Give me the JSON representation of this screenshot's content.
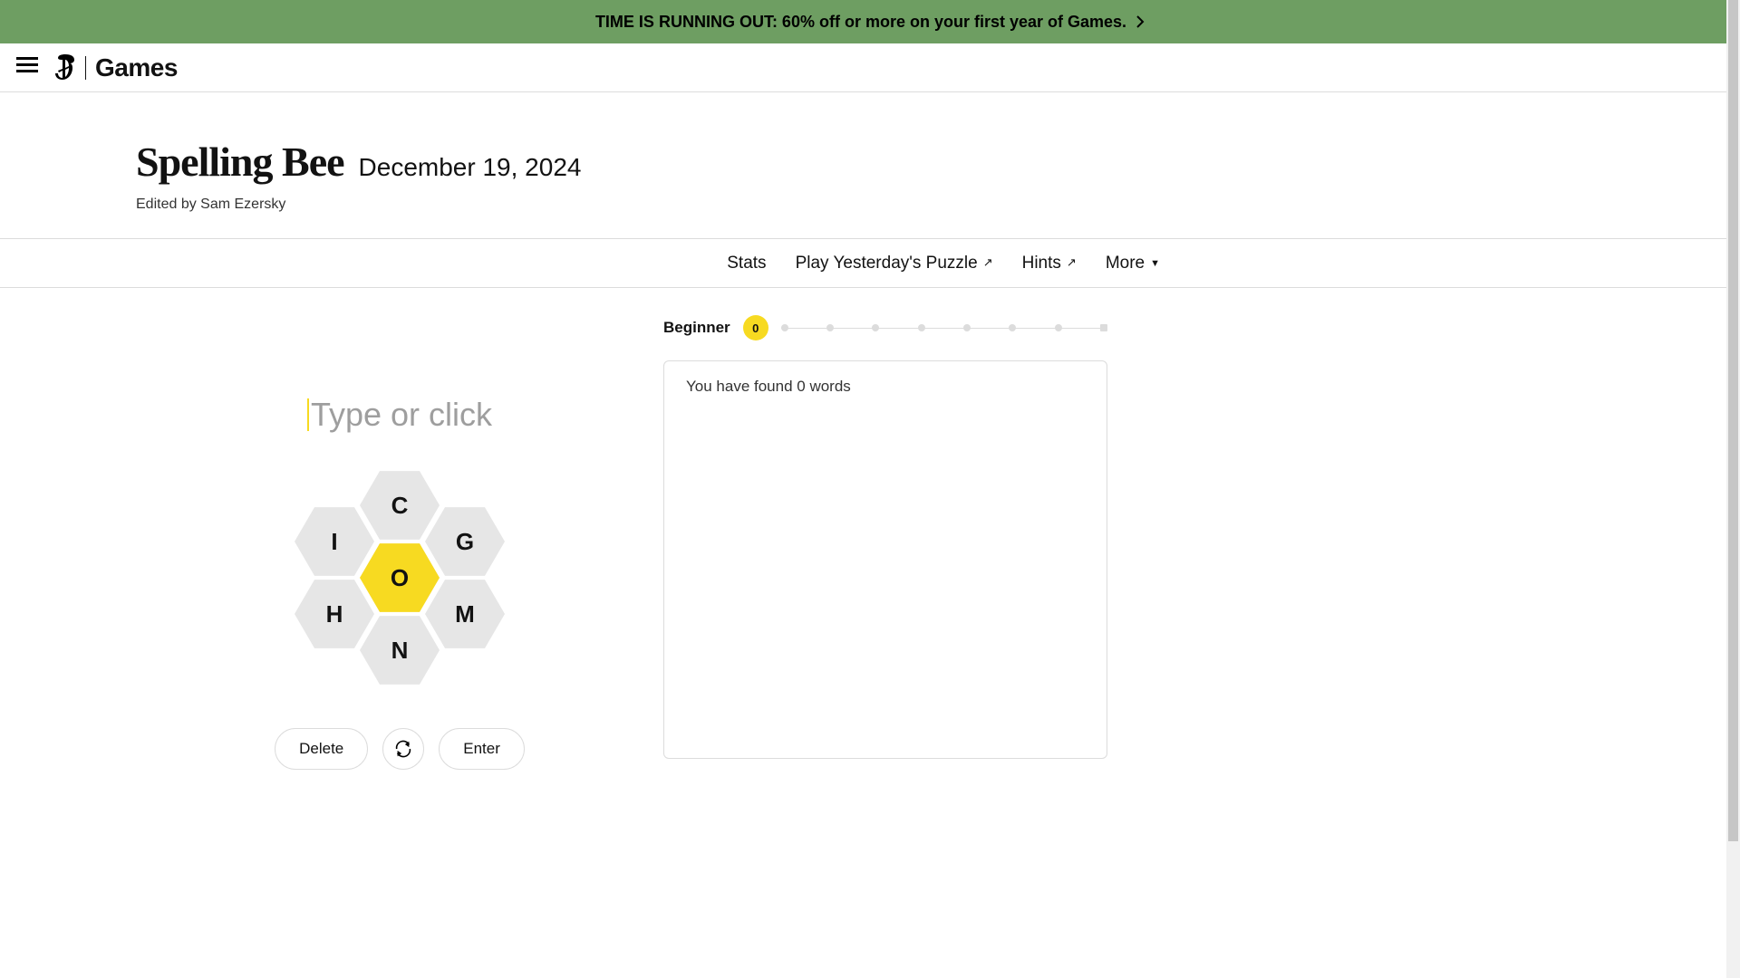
{
  "promo": {
    "text": "TIME IS RUNNING OUT: 60% off or more on your first year of Games."
  },
  "brand": {
    "word": "Games"
  },
  "title": {
    "game": "Spelling Bee",
    "date": "December 19, 2024",
    "byline": "Edited by Sam Ezersky"
  },
  "subnav": {
    "stats": "Stats",
    "yesterday": "Play Yesterday's Puzzle",
    "hints": "Hints",
    "more": "More"
  },
  "input": {
    "placeholder": "Type or click"
  },
  "hive": {
    "center": "O",
    "top": "C",
    "top_right": "G",
    "bottom_right": "M",
    "bottom": "N",
    "bottom_left": "H",
    "top_left": "I"
  },
  "controls": {
    "delete": "Delete",
    "enter": "Enter"
  },
  "progress": {
    "rank": "Beginner",
    "score": "0"
  },
  "found": {
    "summary": "You have found 0 words"
  }
}
